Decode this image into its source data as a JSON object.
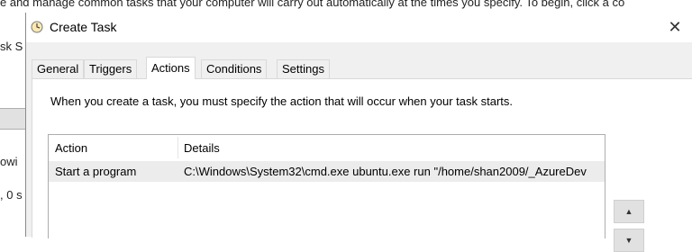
{
  "background_window": {
    "top_text": "e and manage common tasks that your computer will carry out automatically at the times you specify. To begin, click a co",
    "left_fragment_1": "sk S",
    "left_fragment_2": "owi",
    "left_fragment_3": ", 0 s"
  },
  "dialog": {
    "title": "Create Task",
    "close_glyph": "✕",
    "tabs": [
      {
        "label": "General",
        "active": false
      },
      {
        "label": "Triggers",
        "active": false
      },
      {
        "label": "Actions",
        "active": true
      },
      {
        "label": "Conditions",
        "active": false
      },
      {
        "label": "Settings",
        "active": false
      }
    ],
    "description": "When you create a task, you must specify the action that will occur when your task starts.",
    "actions_list": {
      "columns": [
        "Action",
        "Details"
      ],
      "rows": [
        {
          "action": "Start a program",
          "details": "C:\\Windows\\System32\\cmd.exe ubuntu.exe run \"/home/shan2009/_AzureDev"
        }
      ]
    },
    "move_up_glyph": "▲",
    "move_down_glyph": "▼"
  },
  "colors": {
    "dialog_bg": "#f0f0f0",
    "selected_row": "#ececec",
    "button_bg": "#e1e1e1"
  }
}
